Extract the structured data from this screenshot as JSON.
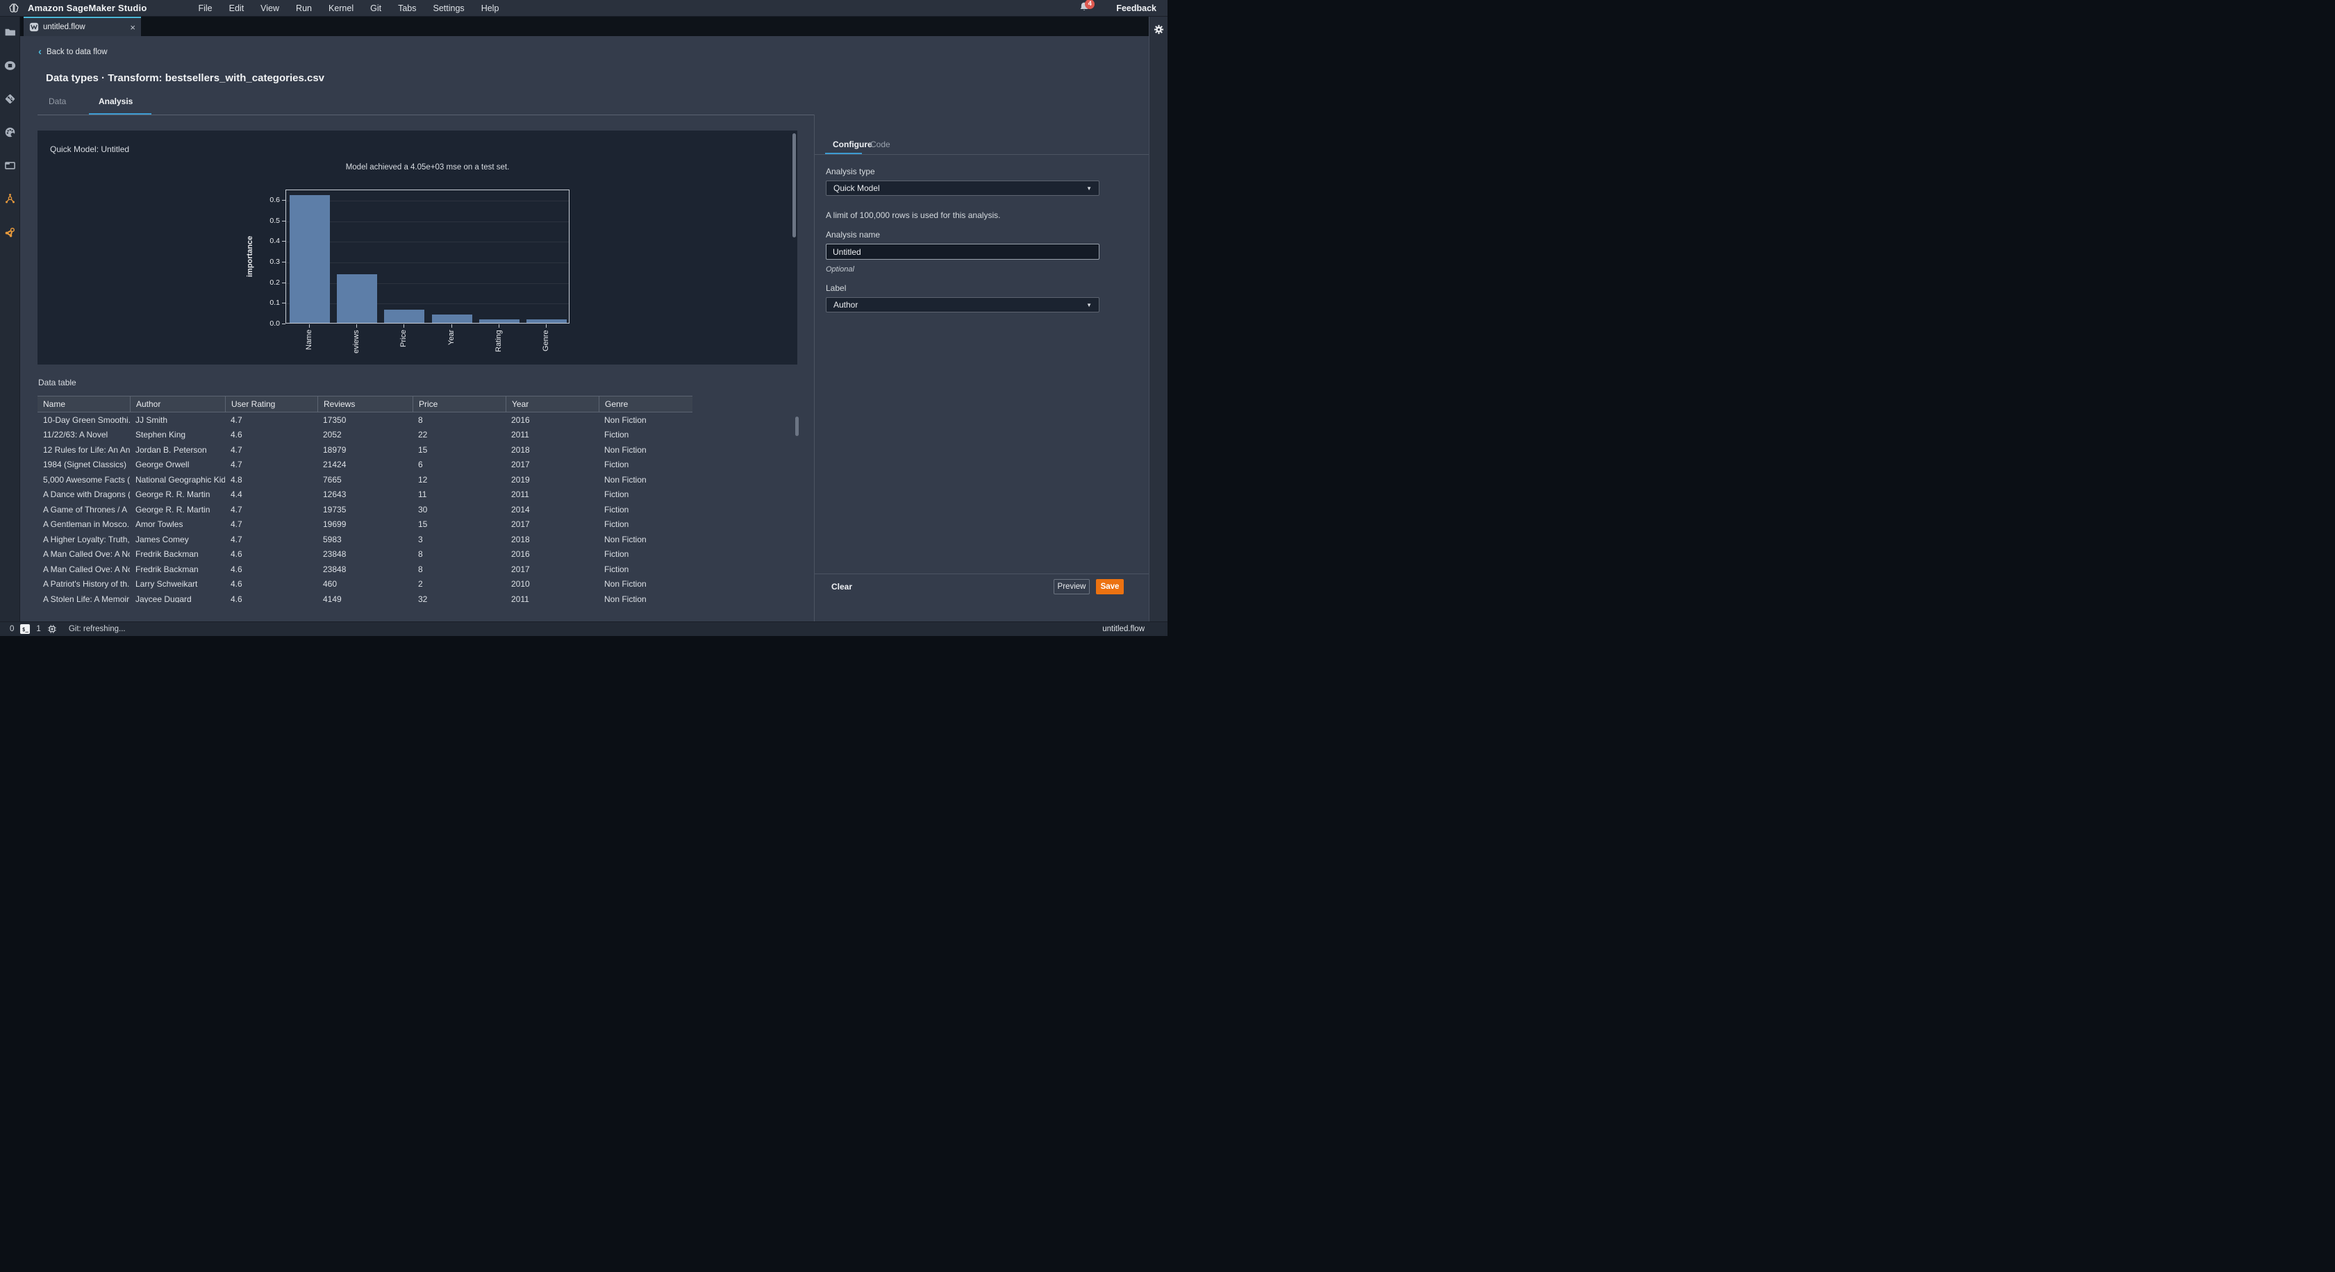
{
  "menubar": {
    "app_title": "Amazon SageMaker Studio",
    "menus": [
      "File",
      "Edit",
      "View",
      "Run",
      "Kernel",
      "Git",
      "Tabs",
      "Settings",
      "Help"
    ],
    "notification_count": "4",
    "feedback_label": "Feedback"
  },
  "tabstrip": {
    "active_tab": "untitled.flow"
  },
  "sidebar": {
    "icons": [
      "file-browser",
      "running-kernels",
      "git",
      "commands-palette",
      "open-tabs",
      "sagemaker-components",
      "sagemaker-jumpstart"
    ]
  },
  "page": {
    "back_link": "Back to data flow",
    "title": "Data types · Transform: bestsellers_with_categories.csv",
    "tab_data": "Data",
    "tab_analysis": "Analysis"
  },
  "quick_model": {
    "heading": "Quick Model: Untitled"
  },
  "chart_data": {
    "type": "bar",
    "title": "Model achieved a 4.05e+03 mse on a test set.",
    "ylabel": "importance",
    "xlabel": "",
    "categories": [
      "Name",
      "eviews",
      "Price",
      "Year",
      "Rating",
      "Genre"
    ],
    "values": [
      0.62,
      0.235,
      0.065,
      0.04,
      0.018,
      0.017
    ],
    "ylim": [
      0,
      0.65
    ],
    "yticks": [
      "0.0",
      "0.1",
      "0.2",
      "0.3",
      "0.4",
      "0.5",
      "0.6"
    ],
    "grid": true,
    "legend": false,
    "bar_color": "#5d7ea8"
  },
  "data_table": {
    "label": "Data table",
    "columns": [
      "Name",
      "Author",
      "User Rating",
      "Reviews",
      "Price",
      "Year",
      "Genre"
    ],
    "rows": [
      [
        "10-Day Green Smoothi...",
        "JJ Smith",
        "4.7",
        "17350",
        "8",
        "2016",
        "Non Fiction"
      ],
      [
        "11/22/63: A Novel",
        "Stephen King",
        "4.6",
        "2052",
        "22",
        "2011",
        "Fiction"
      ],
      [
        "12 Rules for Life: An An...",
        "Jordan B. Peterson",
        "4.7",
        "18979",
        "15",
        "2018",
        "Non Fiction"
      ],
      [
        "1984 (Signet Classics)",
        "George Orwell",
        "4.7",
        "21424",
        "6",
        "2017",
        "Fiction"
      ],
      [
        "5,000 Awesome Facts (...",
        "National Geographic Kids",
        "4.8",
        "7665",
        "12",
        "2019",
        "Non Fiction"
      ],
      [
        "A Dance with Dragons (...",
        "George R. R. Martin",
        "4.4",
        "12643",
        "11",
        "2011",
        "Fiction"
      ],
      [
        "A Game of Thrones / A ...",
        "George R. R. Martin",
        "4.7",
        "19735",
        "30",
        "2014",
        "Fiction"
      ],
      [
        "A Gentleman in Mosco...",
        "Amor Towles",
        "4.7",
        "19699",
        "15",
        "2017",
        "Fiction"
      ],
      [
        "A Higher Loyalty: Truth,...",
        "James Comey",
        "4.7",
        "5983",
        "3",
        "2018",
        "Non Fiction"
      ],
      [
        "A Man Called Ove: A No...",
        "Fredrik Backman",
        "4.6",
        "23848",
        "8",
        "2016",
        "Fiction"
      ],
      [
        "A Man Called Ove: A No...",
        "Fredrik Backman",
        "4.6",
        "23848",
        "8",
        "2017",
        "Fiction"
      ],
      [
        "A Patriot's History of th...",
        "Larry Schweikart",
        "4.6",
        "460",
        "2",
        "2010",
        "Non Fiction"
      ],
      [
        "A Stolen Life: A Memoir",
        "Jaycee Dugard",
        "4.6",
        "4149",
        "32",
        "2011",
        "Non Fiction"
      ]
    ]
  },
  "config_panel": {
    "tab_configure": "Configure",
    "tab_code": "Code",
    "analysis_type_label": "Analysis type",
    "analysis_type_value": "Quick Model",
    "limit_note": "A limit of 100,000 rows is used for this analysis.",
    "analysis_name_label": "Analysis name",
    "analysis_name_value": "Untitled",
    "optional_label": "Optional",
    "label_label": "Label",
    "label_value": "Author",
    "clear_label": "Clear",
    "preview_label": "Preview",
    "save_label": "Save"
  },
  "statusbar": {
    "terminals_count": "0",
    "kernels_count": "1",
    "git_status": "Git: refreshing...",
    "active_file": "untitled.flow"
  },
  "colors": {
    "save_orange": "#ec7211",
    "tab_accent": "#4cb8d8",
    "badge_red": "#dd5950",
    "bar_fill": "#5d7ea8",
    "icon_orange": "#e89a3c"
  }
}
